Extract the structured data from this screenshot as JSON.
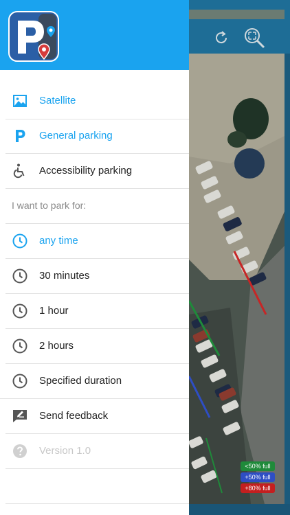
{
  "menu": {
    "layers": [
      {
        "label": "Satellite",
        "icon": "satellite-image-icon",
        "active": true
      },
      {
        "label": "General parking",
        "icon": "parking-p-icon",
        "active": true
      },
      {
        "label": "Accessibility parking",
        "icon": "wheelchair-icon",
        "active": false
      }
    ],
    "duration_header": "I want to park for:",
    "durations": [
      {
        "label": "any time",
        "icon": "clock-icon",
        "active": true
      },
      {
        "label": "30 minutes",
        "icon": "clock-icon",
        "active": false
      },
      {
        "label": "1 hour",
        "icon": "clock-icon",
        "active": false
      },
      {
        "label": "2 hours",
        "icon": "clock-icon",
        "active": false
      },
      {
        "label": "Specified duration",
        "icon": "clock-icon",
        "active": false
      }
    ],
    "feedback": {
      "label": "Send feedback",
      "icon": "feedback-icon"
    },
    "version": {
      "label": "Version 1.0",
      "icon": "help-icon"
    }
  },
  "map": {
    "legend": [
      {
        "label": "<50% full",
        "color": "#1f8a3a"
      },
      {
        "label": "+50% full",
        "color": "#2e4ec4"
      },
      {
        "label": "+80% full",
        "color": "#c41f1f"
      }
    ]
  },
  "colors": {
    "accent": "#1aa3ef",
    "header": "#1aa3ef",
    "text": "#222222",
    "muted": "#888888"
  }
}
